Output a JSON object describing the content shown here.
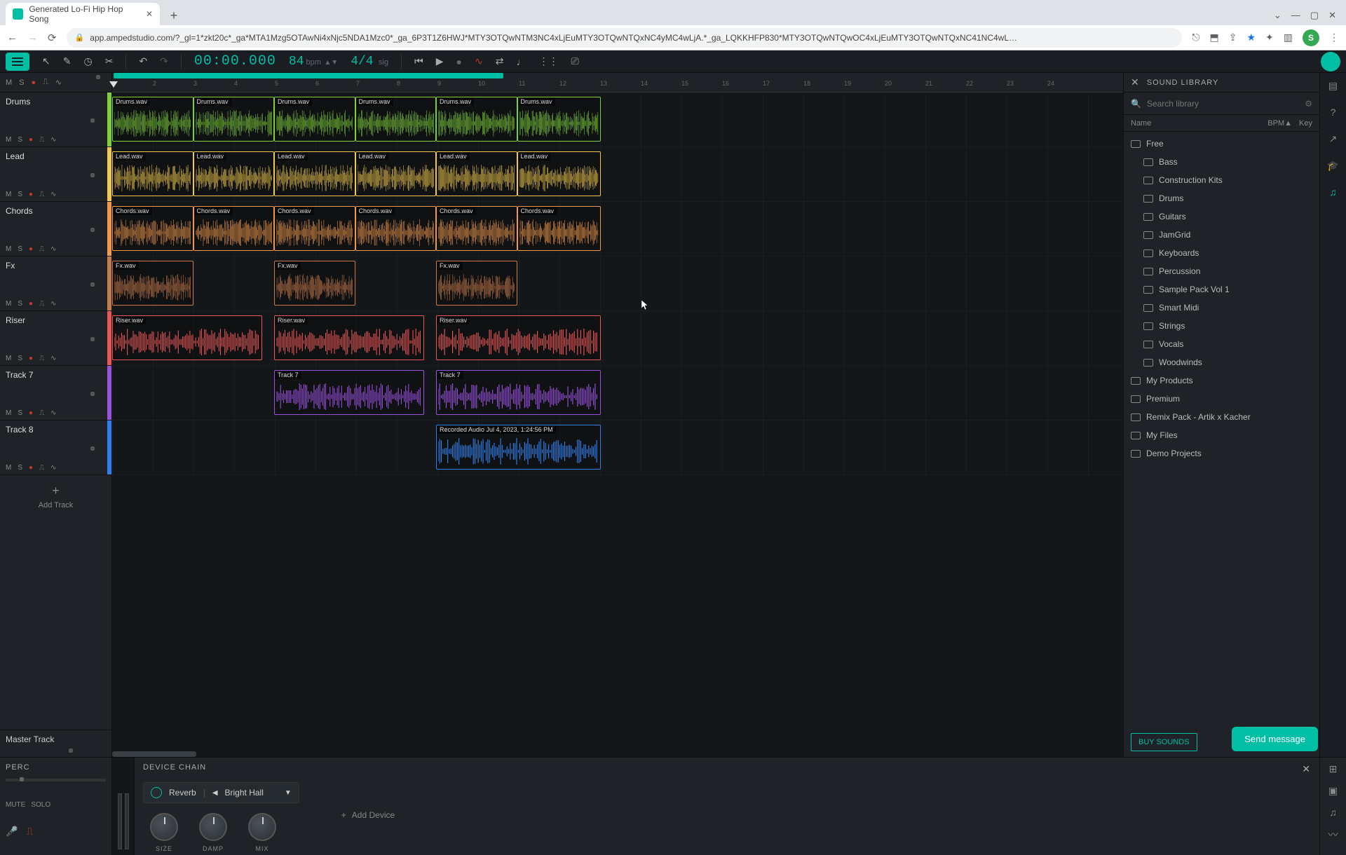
{
  "browser": {
    "tab_title": "Generated Lo-Fi Hip Hop Song",
    "url": "app.ampedstudio.com/?_gl=1*zkt20c*_ga*MTA1Mzg5OTAwNi4xNjc5NDA1Mzc0*_ga_6P3T1Z6HWJ*MTY3OTQwNTM3NC4xLjEuMTY3OTQwNTQxNC4yMC4wLjA.*_ga_LQKKHFP830*MTY3OTQwNTQwOC4xLjEuMTY3OTQwNTQxNC41NC4wL…",
    "profile_initial": "S"
  },
  "transport": {
    "time": "00:00.000",
    "bpm": "84",
    "bpm_label": "bpm",
    "signature": "4/4",
    "sig_label": "sig"
  },
  "ruler_markers": [
    "2",
    "3",
    "4",
    "5",
    "6",
    "7",
    "8",
    "9",
    "10",
    "11",
    "12",
    "13",
    "14",
    "15",
    "16",
    "17",
    "18",
    "19",
    "20",
    "21",
    "22",
    "23",
    "24"
  ],
  "loop": {
    "start_pct": 0,
    "end_pct": 40
  },
  "tracks": [
    {
      "name": "Drums",
      "color": "#7fd13b",
      "clips": [
        {
          "label": "Drums.wav",
          "start": 0,
          "len": 6.6
        },
        {
          "label": "Drums.wav",
          "start": 6.6,
          "len": 6.6
        },
        {
          "label": "Drums.wav",
          "start": 13.2,
          "len": 6.6
        },
        {
          "label": "Drums.wav",
          "start": 19.8,
          "len": 6.6
        },
        {
          "label": "Drums.wav",
          "start": 26.4,
          "len": 6.6
        },
        {
          "label": "Drums.wav",
          "start": 33.0,
          "len": 6.8
        }
      ]
    },
    {
      "name": "Lead",
      "color": "#f2c94c",
      "clips": [
        {
          "label": "Lead.wav",
          "start": 0,
          "len": 6.6
        },
        {
          "label": "Lead.wav",
          "start": 6.6,
          "len": 6.6
        },
        {
          "label": "Lead.wav",
          "start": 13.2,
          "len": 6.6
        },
        {
          "label": "Lead.wav",
          "start": 19.8,
          "len": 6.6
        },
        {
          "label": "Lead.wav",
          "start": 26.4,
          "len": 6.6
        },
        {
          "label": "Lead.wav",
          "start": 33.0,
          "len": 6.8
        }
      ]
    },
    {
      "name": "Chords",
      "color": "#f2994a",
      "clips": [
        {
          "label": "Chords.wav",
          "start": 0,
          "len": 6.6
        },
        {
          "label": "Chords.wav",
          "start": 6.6,
          "len": 6.6
        },
        {
          "label": "Chords.wav",
          "start": 13.2,
          "len": 6.6
        },
        {
          "label": "Chords.wav",
          "start": 19.8,
          "len": 6.6
        },
        {
          "label": "Chords.wav",
          "start": 26.4,
          "len": 6.6
        },
        {
          "label": "Chords.wav",
          "start": 33.0,
          "len": 6.8
        }
      ]
    },
    {
      "name": "Fx",
      "color": "#c97b4a",
      "clips": [
        {
          "label": "Fx.wav",
          "start": 0,
          "len": 6.6
        },
        {
          "label": "Fx.wav",
          "start": 13.2,
          "len": 6.6
        },
        {
          "label": "Fx.wav",
          "start": 26.4,
          "len": 6.6
        }
      ]
    },
    {
      "name": "Riser",
      "color": "#eb5757",
      "clips": [
        {
          "label": "Riser.wav",
          "start": 0,
          "len": 12.2
        },
        {
          "label": "Riser.wav",
          "start": 13.2,
          "len": 12.2
        },
        {
          "label": "Riser.wav",
          "start": 26.4,
          "len": 13.4
        }
      ]
    },
    {
      "name": "Track 7",
      "color": "#9b51e0",
      "clips": [
        {
          "label": "Track 7",
          "start": 13.2,
          "len": 12.2
        },
        {
          "label": "Track 7",
          "start": 26.4,
          "len": 13.4
        }
      ]
    },
    {
      "name": "Track 8",
      "color": "#2f80ed",
      "clips": [
        {
          "label": "Recorded Audio Jul 4, 2023, 1:24:56 PM",
          "start": 26.4,
          "len": 13.4
        }
      ]
    }
  ],
  "track_btns": {
    "m": "M",
    "s": "S"
  },
  "add_track_label": "Add Track",
  "master_label": "Master Track",
  "library": {
    "title": "SOUND LIBRARY",
    "search_placeholder": "Search library",
    "cols": {
      "name": "Name",
      "bpm": "BPM▲",
      "key": "Key"
    },
    "tree": [
      {
        "label": "Free",
        "sub": false
      },
      {
        "label": "Bass",
        "sub": true
      },
      {
        "label": "Construction Kits",
        "sub": true
      },
      {
        "label": "Drums",
        "sub": true
      },
      {
        "label": "Guitars",
        "sub": true
      },
      {
        "label": "JamGrid",
        "sub": true
      },
      {
        "label": "Keyboards",
        "sub": true
      },
      {
        "label": "Percussion",
        "sub": true
      },
      {
        "label": "Sample Pack Vol 1",
        "sub": true
      },
      {
        "label": "Smart Midi",
        "sub": true
      },
      {
        "label": "Strings",
        "sub": true
      },
      {
        "label": "Vocals",
        "sub": true
      },
      {
        "label": "Woodwinds",
        "sub": true
      },
      {
        "label": "My Products",
        "sub": false
      },
      {
        "label": "Premium",
        "sub": false
      },
      {
        "label": "Remix Pack - Artik x Kacher",
        "sub": false
      },
      {
        "label": "My Files",
        "sub": false
      },
      {
        "label": "Demo Projects",
        "sub": false
      }
    ],
    "buy_label": "BUY SOUNDS"
  },
  "device": {
    "left_title": "PERC",
    "mute": "MUTE",
    "solo": "SOLO",
    "chain_title": "DEVICE CHAIN",
    "effect_name": "Reverb",
    "preset": "Bright Hall",
    "knobs": [
      "SIZE",
      "DAMP",
      "MIX"
    ],
    "add_device": "Add Device"
  },
  "send_message": "Send message"
}
